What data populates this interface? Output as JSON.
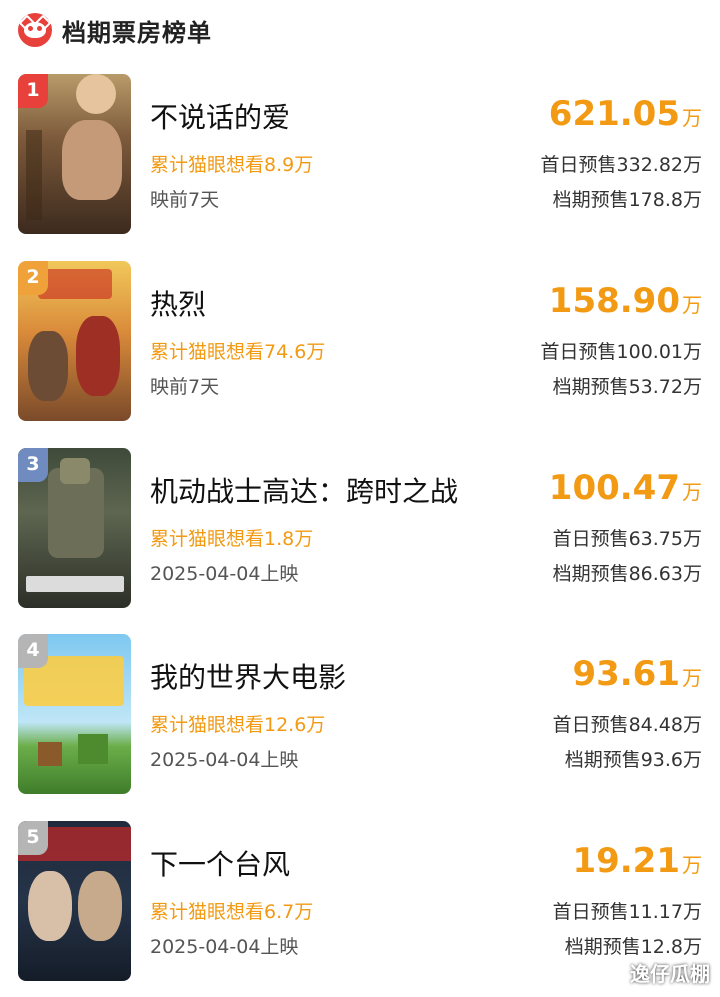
{
  "header": {
    "title": "档期票房榜单",
    "logo": "maoyan-cat-logo",
    "brand_color": "#e8413c"
  },
  "accent_color": "#f29a13",
  "movies": [
    {
      "rank": "1",
      "title": "不说话的爱",
      "box": "621.05",
      "unit": "万",
      "want": "累计猫眼想看8.9万",
      "release": "映前7天",
      "first_day": "首日预售332.82万",
      "period": "档期预售178.8万",
      "rank_color": "#e8413c"
    },
    {
      "rank": "2",
      "title": "热烈",
      "box": "158.90",
      "unit": "万",
      "want": "累计猫眼想看74.6万",
      "release": "映前7天",
      "first_day": "首日预售100.01万",
      "period": "档期预售53.72万",
      "rank_color": "#f0a23a"
    },
    {
      "rank": "3",
      "title": "机动战士高达：跨时之战",
      "box": "100.47",
      "unit": "万",
      "want": "累计猫眼想看1.8万",
      "release": "2025-04-04上映",
      "first_day": "首日预售63.75万",
      "period": "档期预售86.63万",
      "rank_color": "#6f8bbf"
    },
    {
      "rank": "4",
      "title": "我的世界大电影",
      "box": "93.61",
      "unit": "万",
      "want": "累计猫眼想看12.6万",
      "release": "2025-04-04上映",
      "first_day": "首日预售84.48万",
      "period": "档期预售93.6万",
      "rank_color": "#b5b5b5"
    },
    {
      "rank": "5",
      "title": "下一个台风",
      "box": "19.21",
      "unit": "万",
      "want": "累计猫眼想看6.7万",
      "release": "2025-04-04上映",
      "first_day": "首日预售11.17万",
      "period": "档期预售12.8万",
      "rank_color": "#b5b5b5"
    }
  ],
  "watermark": "逸仔瓜棚"
}
